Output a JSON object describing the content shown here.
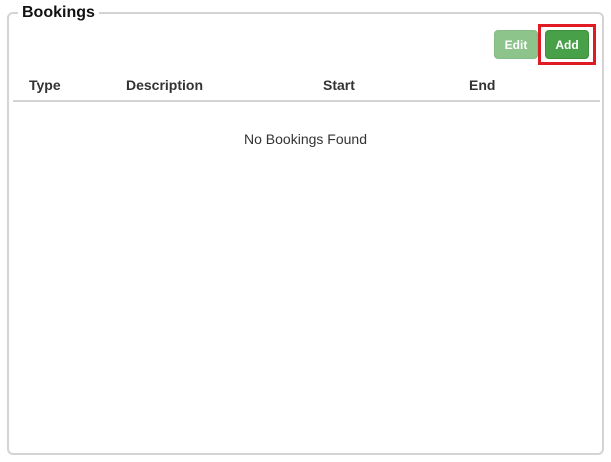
{
  "panel": {
    "title": "Bookings"
  },
  "toolbar": {
    "edit_label": "Edit",
    "add_label": "Add",
    "highlight_color": "#e01b24"
  },
  "table": {
    "columns": [
      "Type",
      "Description",
      "Start",
      "End"
    ],
    "empty_message": "No Bookings Found"
  },
  "colors": {
    "edit_button": "#8cc48c",
    "add_button": "#48a048",
    "border": "#d4d4d4"
  }
}
